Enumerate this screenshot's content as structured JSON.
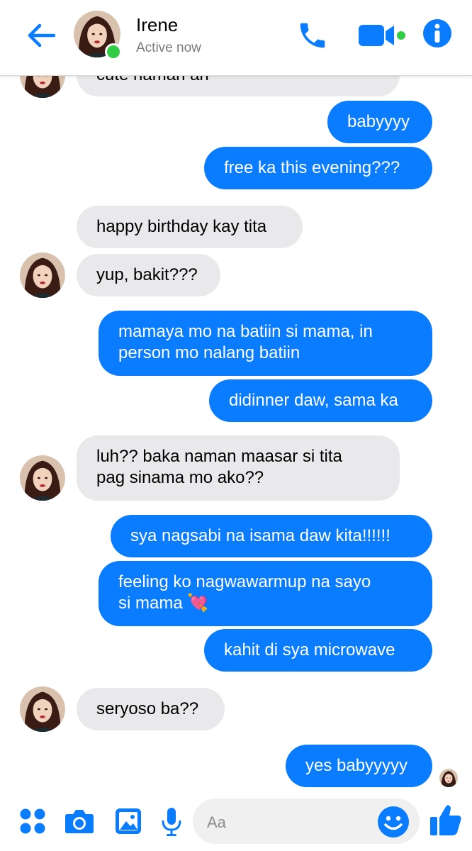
{
  "header": {
    "contact_name": "Irene",
    "status": "Active now",
    "icons": [
      "back-arrow-icon",
      "phone-icon",
      "video-camera-icon",
      "info-icon"
    ]
  },
  "colors": {
    "accent": "#0a7cff",
    "incoming_bubble": "#e9e9eb",
    "presence": "#31cc46"
  },
  "messages": [
    {
      "from": "them",
      "text": "cute naman ah"
    },
    {
      "from": "me",
      "text": "babyyyy"
    },
    {
      "from": "me",
      "text": "free ka this evening???"
    },
    {
      "from": "them",
      "text": "happy birthday kay tita"
    },
    {
      "from": "them",
      "text": "yup, bakit???"
    },
    {
      "from": "me",
      "text": "mamaya mo na batiin si mama, in\nperson mo nalang batiin"
    },
    {
      "from": "me",
      "text": "didinner daw, sama ka"
    },
    {
      "from": "them",
      "text": "luh?? baka naman maasar si tita\npag sinama mo ako??"
    },
    {
      "from": "me",
      "text": "sya nagsabi na isama daw kita!!!!!!"
    },
    {
      "from": "me",
      "text": "feeling ko nagwawarmup na sayo\nsi mama 💘"
    },
    {
      "from": "me",
      "text": "kahit di sya microwave"
    },
    {
      "from": "them",
      "text": "seryoso ba??"
    },
    {
      "from": "me",
      "text": "yes babyyyyy"
    }
  ],
  "composer": {
    "placeholder": "Aa",
    "icons": [
      "apps-grid-icon",
      "camera-icon",
      "gallery-icon",
      "microphone-icon",
      "emoji-icon",
      "thumbs-up-icon"
    ]
  }
}
